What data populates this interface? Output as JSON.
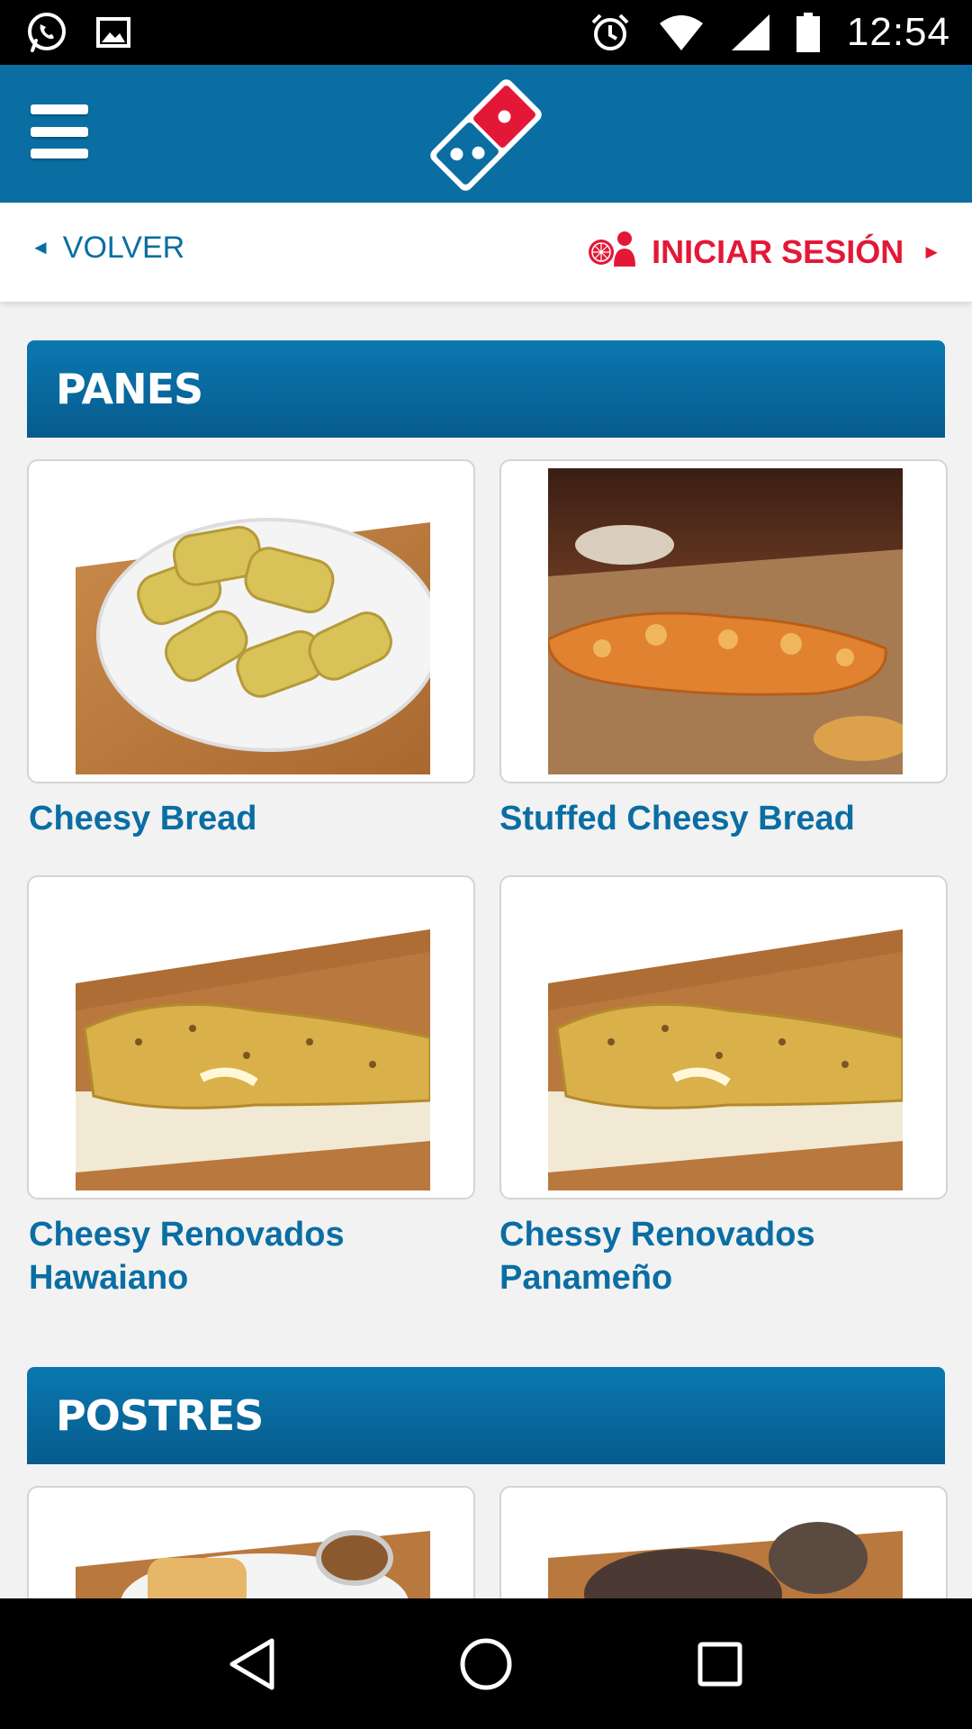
{
  "status_bar": {
    "time": "12:54",
    "left_icons": [
      "whatsapp-icon",
      "image-icon"
    ],
    "right_icons": [
      "alarm-icon",
      "wifi-icon",
      "signal-icon",
      "battery-icon"
    ]
  },
  "app_bar": {
    "menu_icon": "hamburger-menu-icon",
    "logo": "dominos-logo",
    "brand_color": "#0a6ea3"
  },
  "sub_bar": {
    "back_label": "VOLVER",
    "login_label": "INICIAR SESIÓN",
    "back_arrow": "◄",
    "login_arrow": "►",
    "login_color": "#e31837"
  },
  "sections": [
    {
      "title": "PANES",
      "items": [
        {
          "label": "Cheesy Bread"
        },
        {
          "label": "Stuffed Cheesy Bread"
        },
        {
          "label": "Cheesy Renovados Hawaiano"
        },
        {
          "label": "Chessy Renovados Panameño"
        }
      ]
    },
    {
      "title": "POSTRES",
      "items": [
        {
          "label": ""
        },
        {
          "label": ""
        }
      ]
    }
  ],
  "nav_bar": {
    "icons": [
      "back-triangle-icon",
      "home-circle-icon",
      "recents-square-icon"
    ]
  }
}
